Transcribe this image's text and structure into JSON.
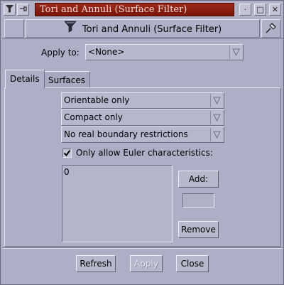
{
  "window": {
    "title": "Tori and Annuli (Surface Filter)",
    "titlebar_buttons": [
      "·",
      "□",
      "✕"
    ]
  },
  "header": {
    "title": "Tori and Annuli (Surface Filter)"
  },
  "apply_to": {
    "label": "Apply to:",
    "value": "<None>"
  },
  "tabs": [
    {
      "label": "Details",
      "active": true
    },
    {
      "label": "Surfaces",
      "active": false
    }
  ],
  "details": {
    "orientability": "Orientable only",
    "compactness": "Compact only",
    "boundary": "No real boundary restrictions",
    "euler_checkbox": {
      "label": "Only allow Euler characteristics:",
      "checked": true
    },
    "euler_list": [
      "0"
    ],
    "add_button": "Add:",
    "add_value": "",
    "remove_button": "Remove"
  },
  "footer": {
    "refresh": "Refresh",
    "apply": "Apply",
    "close": "Close"
  },
  "colors": {
    "title_bar": "#8a1f10",
    "window_bg": "#aeaec6"
  }
}
